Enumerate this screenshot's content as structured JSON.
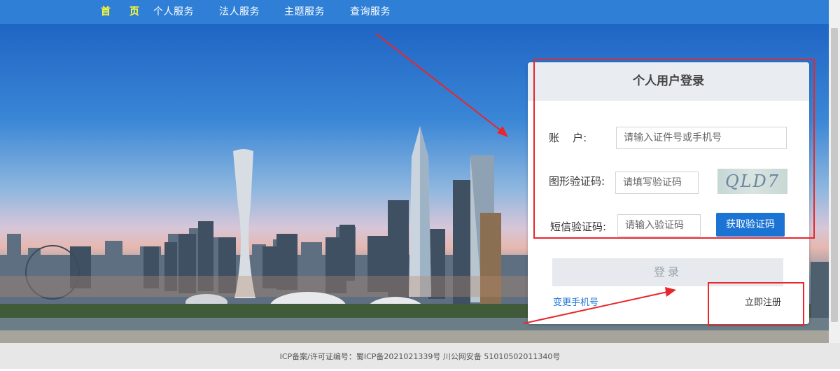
{
  "nav": {
    "items": [
      {
        "label": "首页",
        "active": true
      },
      {
        "label": "个人服务",
        "active": false
      },
      {
        "label": "法人服务",
        "active": false
      },
      {
        "label": "主题服务",
        "active": false
      },
      {
        "label": "查询服务",
        "active": false
      }
    ],
    "home_label": "首  页"
  },
  "login": {
    "title": "个人用户登录",
    "account_label": "账    户:",
    "account_placeholder": "请输入证件号或手机号",
    "captcha_label": "图形验证码:",
    "captcha_placeholder": "请填写验证码",
    "captcha_text": "QLD7",
    "sms_label": "短信验证码:",
    "sms_placeholder": "请输入验证码",
    "sms_button": "获取验证码",
    "login_button": "登录",
    "change_phone_link": "变更手机号",
    "register_link": "立即注册"
  },
  "footer": {
    "text": "ICP备案/许可证编号：蜀ICP备2021021339号 川公网安备 51010502011340号"
  },
  "colors": {
    "nav_bg": "#2f7fd7",
    "nav_active": "#ffff2e",
    "primary_button": "#1b74d4",
    "annotation": "#e8262c"
  }
}
